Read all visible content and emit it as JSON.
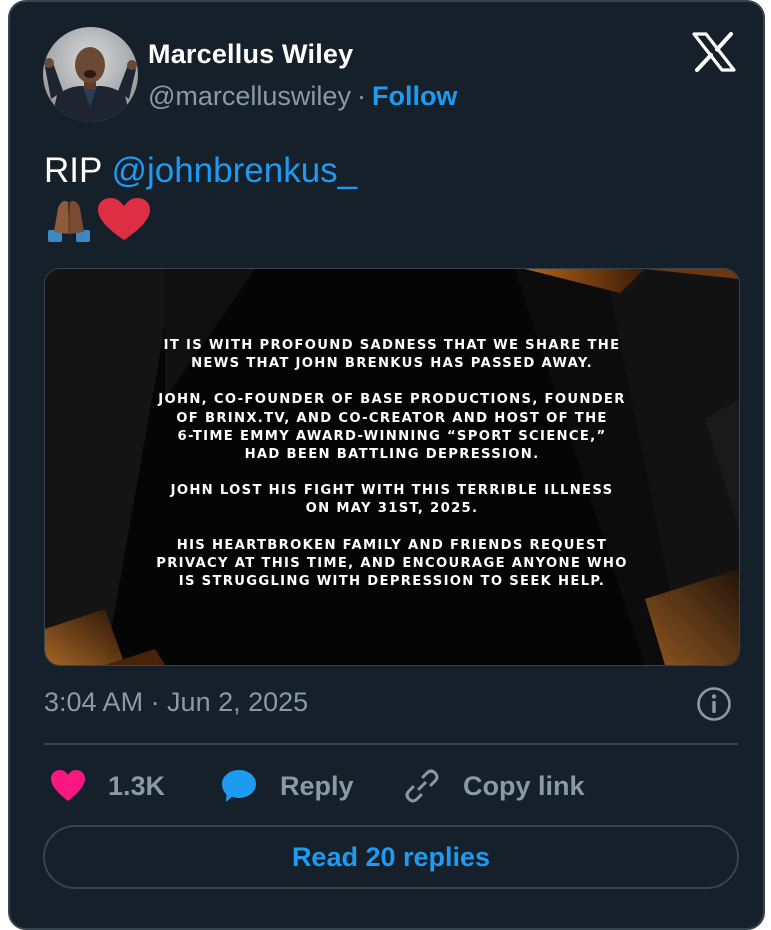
{
  "author": {
    "display_name": "Marcellus Wiley",
    "handle": "@marcelluswiley",
    "separator": "·",
    "follow_label": "Follow"
  },
  "tweet": {
    "text_prefix": "RIP ",
    "mention": "@johnbrenkus_",
    "emoji_line": "🙏🏾❤️"
  },
  "media": {
    "paragraphs": [
      "IT IS WITH PROFOUND SADNESS THAT WE SHARE THE\nNEWS THAT JOHN BRENKUS HAS PASSED AWAY.",
      "JOHN, CO-FOUNDER OF BASE PRODUCTIONS, FOUNDER\nOF BRINX.TV, AND CO-CREATOR AND HOST OF THE\n6-TIME EMMY AWARD-WINNING “SPORT SCIENCE,”\nHAD BEEN BATTLING DEPRESSION.",
      "JOHN LOST HIS FIGHT WITH THIS TERRIBLE ILLNESS\nON MAY 31ST, 2025.",
      "HIS HEARTBROKEN FAMILY AND FRIENDS REQUEST\nPRIVACY AT THIS TIME, AND ENCOURAGE ANYONE WHO\nIS STRUGGLING WITH DEPRESSION TO SEEK HELP."
    ]
  },
  "timestamp": "3:04 AM · Jun 2, 2025",
  "actions": {
    "like_count": "1.3K",
    "reply_label": "Reply",
    "copy_link_label": "Copy link"
  },
  "read_replies_label": "Read 20 replies",
  "colors": {
    "background": "#15202b",
    "border": "#38444d",
    "accent": "#1d9bf0",
    "muted": "#8b98a5",
    "like": "#f91880"
  },
  "icons": [
    "x-logo-icon",
    "info-icon",
    "heart-icon",
    "reply-bubble-icon",
    "link-icon"
  ]
}
